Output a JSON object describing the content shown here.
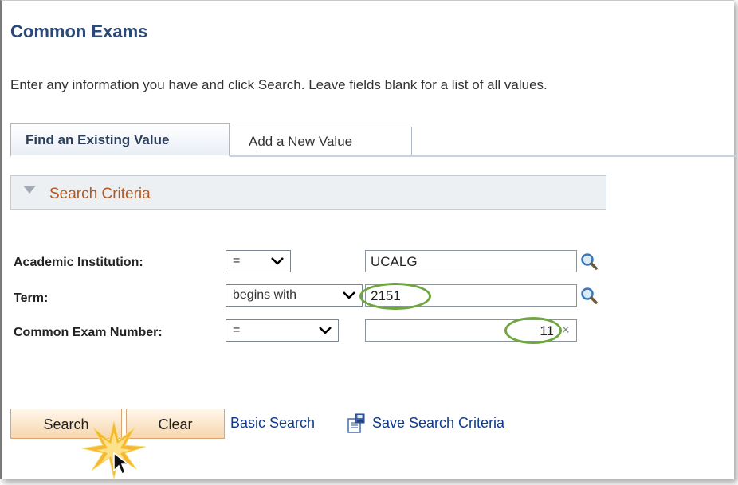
{
  "page": {
    "title": "Common Exams",
    "instructions": "Enter any information you have and click Search. Leave fields blank for a list of all values."
  },
  "tabs": {
    "find_label": "Find an Existing Value",
    "add_hotkey": "A",
    "add_rest": "dd a New Value"
  },
  "search_criteria": {
    "label": "Search Criteria"
  },
  "fields": {
    "institution": {
      "label": "Academic Institution:",
      "operator": "=",
      "value": "UCALG"
    },
    "term": {
      "label": "Term:",
      "operator": "begins with",
      "value": "2151"
    },
    "exam_number": {
      "label": "Common Exam Number:",
      "operator": "=",
      "value": "11",
      "clear": "×"
    }
  },
  "buttons": {
    "search": "Search",
    "clear": "Clear"
  },
  "links": {
    "basic_search": "Basic Search",
    "save_criteria": "Save Search Criteria"
  },
  "colors": {
    "title": "#2b4a7a",
    "criteria_label": "#b3571f",
    "link": "#0f3b8f",
    "highlight": "#6fa640",
    "button_border": "#d9a574"
  },
  "icons": {
    "lookup": "magnifier-icon",
    "save": "save-criteria-icon",
    "cursor": "mouse-pointer-icon"
  }
}
